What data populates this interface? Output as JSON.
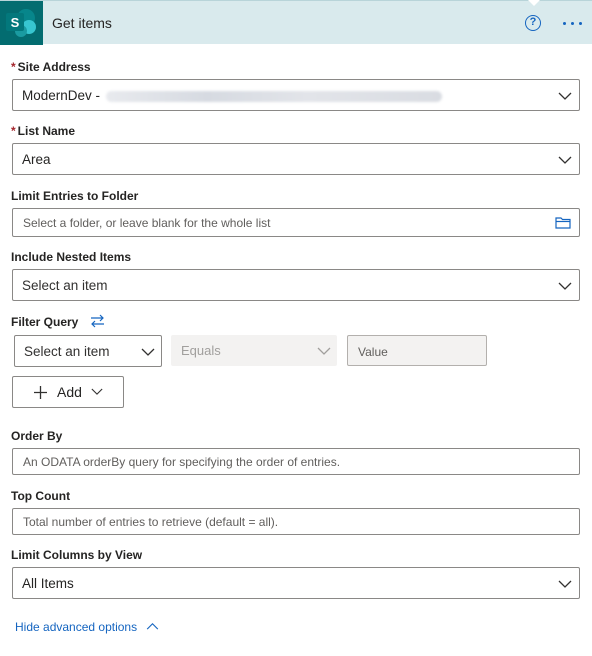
{
  "header": {
    "title": "Get items",
    "logo_letter": "S",
    "help_symbol": "?",
    "accent_color": "#036c70",
    "header_bg": "#d9eaed",
    "icons": [
      "sharepoint-logo-icon",
      "help-icon",
      "more-options-icon"
    ]
  },
  "fields": {
    "site_address": {
      "label": "Site Address",
      "required_mark": "*",
      "value": "ModernDev -"
    },
    "list_name": {
      "label": "List Name",
      "required_mark": "*",
      "value": "Area"
    },
    "limit_folder": {
      "label": "Limit Entries to Folder",
      "placeholder": "Select a folder, or leave blank for the whole list"
    },
    "nested_items": {
      "label": "Include Nested Items",
      "placeholder": "Select an item"
    },
    "filter_query": {
      "label": "Filter Query",
      "field_placeholder": "Select an item",
      "operator": "Equals",
      "value_placeholder": "Value",
      "add_label": "Add"
    },
    "order_by": {
      "label": "Order By",
      "placeholder": "An ODATA orderBy query for specifying the order of entries."
    },
    "top_count": {
      "label": "Top Count",
      "placeholder": "Total number of entries to retrieve (default = all)."
    },
    "columns_view": {
      "label": "Limit Columns by View",
      "value": "All Items"
    }
  },
  "footer": {
    "hide_advanced_label": "Hide advanced options"
  }
}
